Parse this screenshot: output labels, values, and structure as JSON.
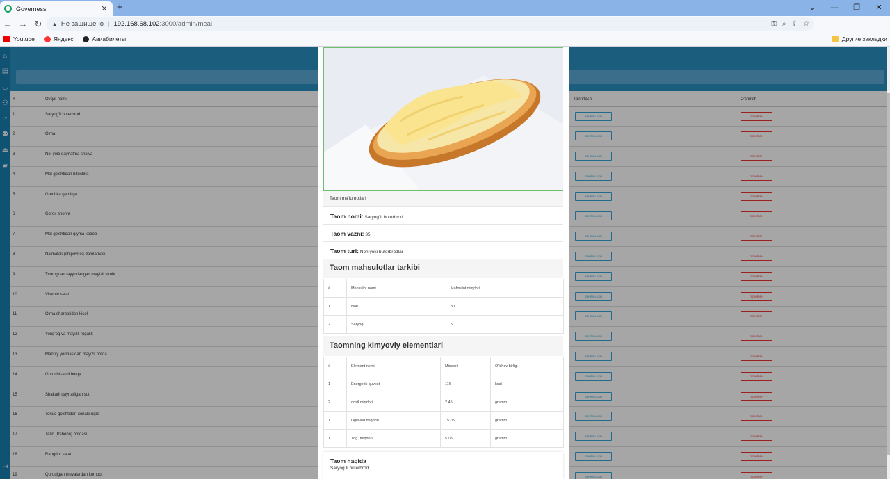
{
  "browser": {
    "tab_title": "Governess",
    "security_label": "Не защищено",
    "url_host": "192.168.68.102",
    "url_path": ":3000/admin/meal",
    "bookmarks": [
      "Youtube",
      "Яндекс",
      "Авиабилеты"
    ],
    "other_bookmarks": "Другие закладки"
  },
  "table": {
    "headers": {
      "num": "#",
      "name": "Ovqat nomi",
      "edit": "Tahrirlash",
      "delete": "O'chirish"
    },
    "edit_label": "TAHRIRLASH",
    "delete_label": "O'CHIRISH",
    "rows": [
      {
        "num": "1",
        "name": "Saryog'li buterbrod"
      },
      {
        "num": "2",
        "name": "Olma"
      },
      {
        "num": "3",
        "name": "Nol yoki qaynatma sho'va"
      },
      {
        "num": "4",
        "name": "Mol go'shtidan bitochka"
      },
      {
        "num": "5",
        "name": "Grechka gamirga"
      },
      {
        "num": "6",
        "name": "Gorox shorva"
      },
      {
        "num": "7",
        "name": "Mol go'shtidan qiyma kabob"
      },
      {
        "num": "8",
        "name": "Na'matak (shipovnik) damlamasi"
      },
      {
        "num": "9",
        "name": "Tvorogdan tayyorlangan mayizli sirnik"
      },
      {
        "num": "10",
        "name": "Vitamin salat"
      },
      {
        "num": "11",
        "name": "Olma sharbatidan kisel"
      },
      {
        "num": "12",
        "name": "Yong'oq va mayizli rogalik"
      },
      {
        "num": "13",
        "name": "Manniy yormasidan mayizli botqa"
      },
      {
        "num": "14",
        "name": "Guruchli-sutli botqa"
      },
      {
        "num": "15",
        "name": "Shakarli qaynatilgan sut"
      },
      {
        "num": "16",
        "name": "Toriuq go'shtidan xonaki ugra"
      },
      {
        "num": "17",
        "name": "Tariq (Psheno) botqasi"
      },
      {
        "num": "18",
        "name": "Rangdor salat"
      },
      {
        "num": "19",
        "name": "Quruqigan mevalardan kompot"
      }
    ]
  },
  "modal": {
    "info_header": "Taom ma'lumotlari",
    "name_label": "Taom nomi:",
    "name_value": "Saryog`li buterbrod",
    "weight_label": "Taom vazni:",
    "weight_value": "35",
    "type_label": "Taom turi:",
    "type_value": "Non yoki buterbrodlar",
    "products_title": "Taom mahsulotlar tarkibi",
    "products_headers": [
      "#",
      "Mahsulot nomi",
      "Mahsulot miqdori"
    ],
    "products": [
      {
        "num": "1",
        "name": "Non",
        "amount": "30"
      },
      {
        "num": "2",
        "name": "Saryog",
        "amount": "5"
      }
    ],
    "elements_title": "Taomning kimyoviy elementlari",
    "elements_headers": [
      "#",
      "Element nomi",
      "Miqdori",
      "O'lchov birligi"
    ],
    "elements": [
      {
        "num": "1",
        "name": "Energetik quvvati",
        "amount": "116",
        "unit": "kcal"
      },
      {
        "num": "2",
        "name": "oqsil miqdori",
        "amount": "2.45",
        "unit": "gramm"
      },
      {
        "num": "1",
        "name": "Uglevod miqdori",
        "amount": "15.05",
        "unit": "gramm"
      },
      {
        "num": "1",
        "name": "Yog` miqdori",
        "amount": "5.05",
        "unit": "gramm"
      }
    ],
    "about_title": "Taom haqida",
    "about_text": "Saryog`li buterbrod"
  }
}
